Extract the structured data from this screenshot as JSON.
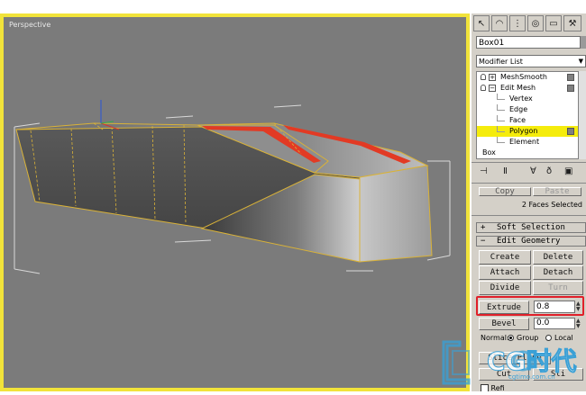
{
  "viewport": {
    "label": "Perspective"
  },
  "panel": {
    "tabs": [
      "arrow",
      "curve",
      "circle",
      "monitor",
      "hammer",
      "T"
    ],
    "object_name": "Box01",
    "modifier_list_label": "Modifier List",
    "stack": [
      {
        "label": "MeshSmooth",
        "level": 0,
        "expander": "+"
      },
      {
        "label": "Edit Mesh",
        "level": 0,
        "expander": "−"
      },
      {
        "label": "Vertex",
        "level": 1
      },
      {
        "label": "Edge",
        "level": 1
      },
      {
        "label": "Face",
        "level": 1
      },
      {
        "label": "Polygon",
        "level": 1,
        "selected": true
      },
      {
        "label": "Element",
        "level": 1
      },
      {
        "label": "Box",
        "level": 0
      }
    ],
    "copy_label": "Copy",
    "paste_label": "Paste",
    "selection_status": "2 Faces Selected",
    "soft_selection_label": "Soft Selection",
    "edit_geometry_label": "Edit Geometry",
    "create_label": "Create",
    "delete_label": "Delete",
    "attach_label": "Attach",
    "detach_label": "Detach",
    "divide_label": "Divide",
    "turn_label": "Turn",
    "extrude_label": "Extrude",
    "extrude_value": "0.8",
    "bevel_label": "Bevel",
    "bevel_value": "0.0",
    "normal_label": "Normal:",
    "group_label": "Group",
    "local_label": "Local",
    "cut_label": "Cut",
    "slice_label": "Sli",
    "slice_plane_label": "Slice Plane",
    "refine_label": "Refi"
  },
  "watermark": {
    "text": "CG时代",
    "subtext": "cgtimo.com.cn"
  },
  "colors": {
    "viewport_border": "#f1e33a",
    "viewport_bg": "#7b7b7b",
    "selection_highlight": "#f5ec0c",
    "selected_polygons": "#e23a24",
    "callout": "#e0202a"
  }
}
